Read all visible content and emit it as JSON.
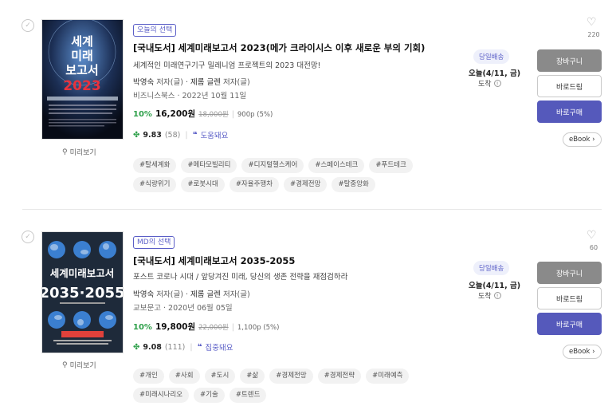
{
  "items": [
    {
      "badge": "오늘의 선택",
      "title_prefix": "[국내도서]",
      "title": "세계미래보고서 2023(메가 크라이시스 이후 새로운 부의 기회)",
      "subtitle": "세계적인 미래연구기구 밀레니엄 프로젝트의 2023 대전망!",
      "author1": "박영숙",
      "author1_role": "저자(글)",
      "author2": "제롬 글렌",
      "author2_role": "저자(글)",
      "author_sep": "·",
      "publisher": "비즈니스북스",
      "pub_date": "2022년 10월 11일",
      "discount": "10%",
      "price": "16,200원",
      "orig_price": "18,000원",
      "points": "900p (5%)",
      "score": "9.83",
      "review_count": "(58)",
      "review_tag": "도움돼요",
      "tags": [
        "#탈세계화",
        "#메타모빌리티",
        "#디지털헬스케어",
        "#스페이스테크",
        "#푸드테크",
        "#식량위기",
        "#로봇시대",
        "#자율주행차",
        "#경제전망",
        "#탈중앙화"
      ],
      "shipping": "당일배송",
      "arrival": "오늘(4/11, 금)",
      "arrival2": "도착",
      "likes": "220",
      "cover_title1": "세계",
      "cover_title2": "미래",
      "cover_title3": "보고서",
      "cover_year": "2023"
    },
    {
      "badge": "MD의 선택",
      "title_prefix": "[국내도서]",
      "title": "세계미래보고서 2035-2055",
      "subtitle": "포스트 코로나 시대 / 앞당겨진 미래, 당신의 생존 전략을 재점검하라",
      "author1": "박영숙",
      "author1_role": "저자(글)",
      "author2": "제롬 글렌",
      "author2_role": "저자(글)",
      "author_sep": "·",
      "publisher": "교보문고",
      "pub_date": "2020년 06월 05일",
      "discount": "10%",
      "price": "19,800원",
      "orig_price": "22,000원",
      "points": "1,100p (5%)",
      "score": "9.08",
      "review_count": "(111)",
      "review_tag": "집중돼요",
      "tags": [
        "#개인",
        "#사회",
        "#도시",
        "#삶",
        "#경제전망",
        "#경제전략",
        "#미래예측",
        "#미래시나리오",
        "#기술",
        "#트렌드"
      ],
      "shipping": "당일배송",
      "arrival": "오늘(4/11, 금)",
      "arrival2": "도착",
      "likes": "60",
      "cover_title1": "세계미래보고서",
      "cover_year": "2035·2055"
    }
  ],
  "labels": {
    "preview": "미리보기",
    "cart": "장바구니",
    "gift": "바로드림",
    "buy": "바로구매",
    "ebook": "eBook"
  },
  "icons": {
    "check": "check-icon",
    "heart": "heart-icon",
    "magnifier": "search-icon",
    "clover": "clover-icon",
    "quote": "quote-icon",
    "info": "info-icon",
    "chevron": "chevron-right-icon"
  },
  "colors": {
    "accent": "#5559bb",
    "discount": "#2ea04a",
    "cart": "#8a8a8a"
  }
}
